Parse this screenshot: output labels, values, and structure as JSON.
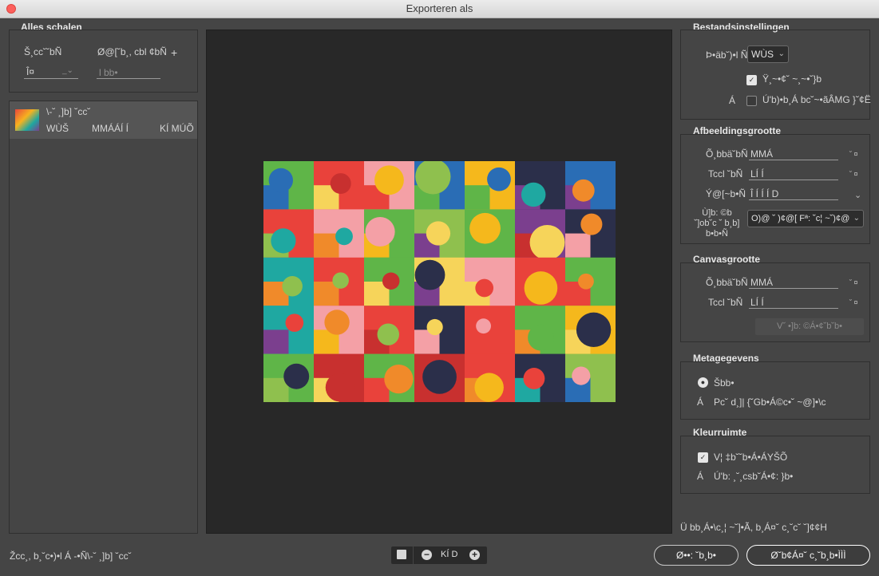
{
  "window": {
    "title": "Exporteren als"
  },
  "left": {
    "section_title": "Alles schalen",
    "col_size": "Š¸cc˘˘bÑ",
    "col_suffix": "Ø@[˘b¸, cbl ¢bÑ",
    "add_symbol": "+",
    "scale_value": "Î¤",
    "suffix_placeholder": "l bb•",
    "asset": {
      "name": "\\-˘ ¸]b] ˘cc˘",
      "format": "WÙŠ",
      "size": "MMÁÁÍ Í",
      "filesize": "KÍ MÚÕ"
    },
    "footer_text": "Žcc¸, b¸˘c•)•l Á -•Ñ\\-˘ ¸]b] ˘cc˘"
  },
  "preview": {
    "zoom_label": "KÍ D"
  },
  "right": {
    "file_settings": {
      "title": "Bestandsinstellingen",
      "format_label": "Þ•äb˘)•l Ñ",
      "format_value": "WÙS",
      "transparency_label": "Ÿ¸~•¢˘ ~¸~•˘}b",
      "smaller_file_label": "Ú'b)•b¸Á bc˘~•ãÂMG }˘¢Ë"
    },
    "image_size": {
      "title": "Afbeeldingsgrootte",
      "width_label": "Õ¸bbä˘bÑ",
      "width_value": "MMÁ",
      "height_label": "Tccl ˘bÑ",
      "height_value": "LÍ Í",
      "scale_label": "Ý@[~b•Ñ",
      "scale_value": "Î Í Í Í D",
      "resample_label": "Ù]b: ©b ˘]ob˘c ˘ b¸b] b•b•Ñ",
      "resample_value": "O)@ ˘ )¢@[ Fª: ˘c¦ ~˘)¢@"
    },
    "canvas_size": {
      "title": "Canvasgrootte",
      "width_label": "Õ¸bbä˘bÑ",
      "width_value": "MMÁ",
      "height_label": "Tccl ˘bÑ",
      "height_value": "LÍ Í",
      "reset_label": "V˘ •]b: ©Á•¢˘b˘b•"
    },
    "metadata": {
      "title": "Metagegevens",
      "option1": "Šbb•",
      "option2": "Pc˘ d¸]| {˘Gb•Á©c•˘ ~@]•\\c"
    },
    "color_space": {
      "title": "Kleurruimte",
      "option1": "V¦ ‡b˘˘b•Á•ÁYŠÕ",
      "option2": "Ú'b: ¸˘¸csb˘Á•¢: }b•"
    },
    "footer_text": "Ü bb¸Á•\\c¸¦ ~˘]•Ã, b¸Á¤˘ c¸˘c˘ ˘]¢¢H"
  },
  "buttons": {
    "cancel": "Ø••: ˘b¸b•",
    "export": "Ø˘b¢Á¤˘ c¸˘b¸b•ÌÌÌ"
  },
  "colors": {
    "window_bg": "#454545",
    "canvas_bg": "#282828",
    "close_button": "#fc605c"
  }
}
